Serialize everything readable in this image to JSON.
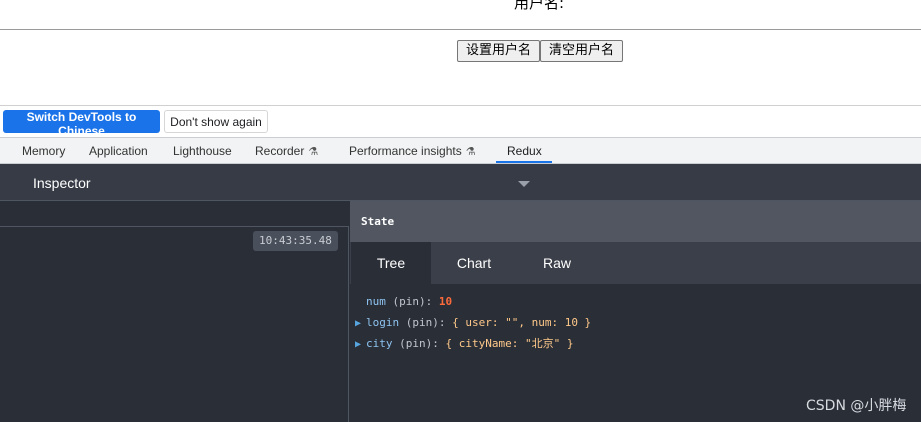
{
  "page": {
    "username_label": "用户名:",
    "buttons": {
      "set": "设置用户名",
      "clear": "清空用户名"
    }
  },
  "devtools": {
    "banner": {
      "switch_label": "Switch DevTools to Chinese",
      "dont_show_label": "Don't show again"
    },
    "tabs": [
      {
        "label": "Memory"
      },
      {
        "label": "Application"
      },
      {
        "label": "Lighthouse"
      },
      {
        "label": "Recorder"
      },
      {
        "label": "Performance insights"
      },
      {
        "label": "Redux",
        "active": true
      }
    ],
    "flask_glyph": "⚗",
    "accent_color": "#1a73e8"
  },
  "redux": {
    "inspector_title": "Inspector",
    "timestamp": "10:43:35.48",
    "state_title": "State",
    "view_tabs": [
      "Tree",
      "Chart",
      "Raw"
    ],
    "tree": [
      {
        "key": "num",
        "pin": " (pin): ",
        "value": "10"
      },
      {
        "key": "login",
        "pin": " (pin): ",
        "value": "{ user: \"\", num: 10 }"
      },
      {
        "key": "city",
        "pin": " (pin): ",
        "value": "{ cityName: \"北京\" }"
      }
    ]
  },
  "watermark": "CSDN @小胖梅"
}
